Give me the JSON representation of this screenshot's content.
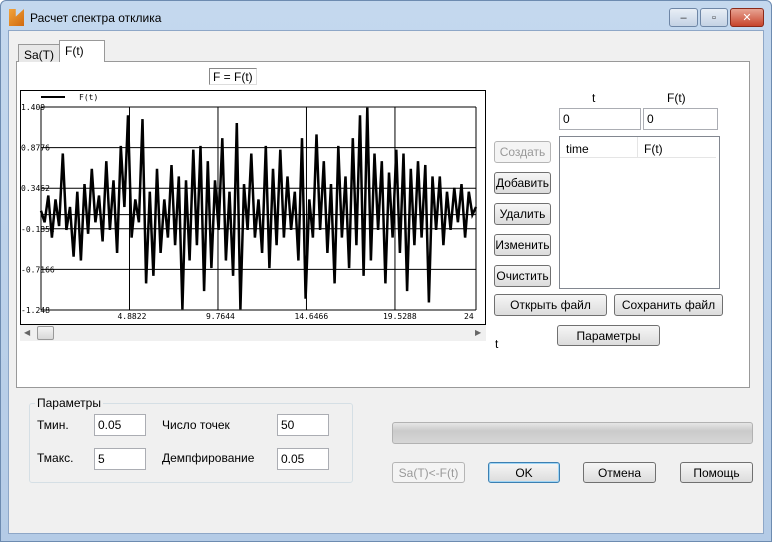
{
  "window": {
    "title": "Расчет спектра отклика",
    "minimize": "‒",
    "maximize": "▫",
    "close": "✕"
  },
  "tabs": [
    {
      "label": "Sa(T)",
      "active": false
    },
    {
      "label": "F(t)",
      "active": true
    }
  ],
  "formula_label": "F = F(t)",
  "chart_data": {
    "type": "line",
    "legend": "F(t)",
    "legend_position": "top-left",
    "xlim": [
      0,
      24
    ],
    "ylim": [
      -1.248,
      1.409
    ],
    "x_ticks": [
      "4.8822",
      "9.7644",
      "14.6466",
      "19.5288",
      "24"
    ],
    "y_ticks": [
      "1.409",
      "0.8776",
      "0.3462",
      "-0.1852",
      "-0.7166",
      "-1.248"
    ],
    "grid": true,
    "x_start": 0,
    "x_step": 0.2,
    "values": [
      0.05,
      -0.1,
      0.25,
      -0.3,
      0.2,
      -0.15,
      0.8,
      -0.2,
      0.1,
      -0.55,
      0.3,
      -0.6,
      0.4,
      -0.25,
      0.6,
      -0.1,
      0.25,
      -0.35,
      0.7,
      -0.2,
      0.45,
      -0.5,
      0.9,
      0.1,
      1.3,
      -0.3,
      0.2,
      -0.1,
      1.25,
      -0.9,
      0.3,
      -0.8,
      0.6,
      -0.5,
      0.2,
      -0.3,
      0.65,
      -0.4,
      0.5,
      -1.24,
      0.45,
      -0.6,
      0.85,
      -0.4,
      0.9,
      -1.0,
      0.7,
      -0.7,
      0.45,
      -0.2,
      1.0,
      -0.6,
      0.3,
      -0.8,
      1.2,
      -1.24,
      0.4,
      -0.2,
      0.8,
      -0.3,
      0.2,
      -0.5,
      0.9,
      -0.7,
      0.6,
      -0.4,
      0.85,
      -0.3,
      0.5,
      -0.2,
      0.3,
      -0.6,
      1.0,
      -1.1,
      0.2,
      -0.3,
      1.05,
      -0.2,
      0.7,
      -0.5,
      0.4,
      -0.9,
      0.9,
      -0.3,
      0.5,
      -0.7,
      1.0,
      -0.4,
      1.3,
      -0.8,
      1.4,
      -0.6,
      0.8,
      -0.2,
      0.7,
      -0.9,
      0.55,
      -0.3,
      0.85,
      -0.5,
      0.8,
      -1.0,
      0.6,
      -0.4,
      0.7,
      -0.3,
      0.65,
      -1.15,
      0.5,
      -0.2,
      0.5,
      -0.4,
      0.3,
      -0.2,
      0.35,
      -0.1,
      0.4,
      -0.3,
      0.3,
      0.0,
      0.1
    ]
  },
  "input_panel": {
    "t_label": "t",
    "f_label": "F(t)",
    "t_value": "0",
    "f_value": "0",
    "table_headers": [
      "time",
      "F(t)"
    ],
    "rows": []
  },
  "buttons": {
    "create": "Создать",
    "add": "Добавить",
    "delete": "Удалить",
    "edit": "Изменить",
    "clear": "Очистить",
    "open_file": "Открыть файл",
    "save_file": "Сохранить файл",
    "params": "Параметры"
  },
  "axis_t_label": "t",
  "params_group": {
    "title": "Параметры",
    "tmin_label": "Тмин.",
    "tmin": "0.05",
    "tmax_label": "Тмакс.",
    "tmax": "5",
    "points_label": "Число точек",
    "points": "50",
    "damping_label": "Демпфирование",
    "damping": "0.05"
  },
  "progress": 0,
  "footer": {
    "convert": "Sa(T)<-F(t)",
    "ok": "OK",
    "cancel": "Отмена",
    "help": "Помощь"
  }
}
